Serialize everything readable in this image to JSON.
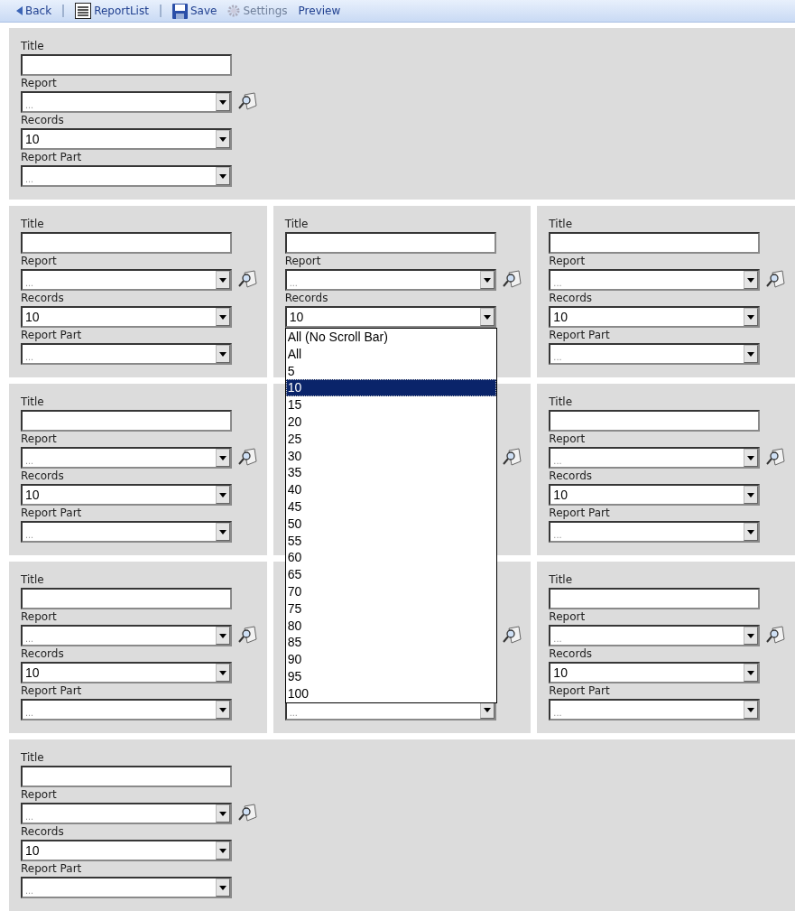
{
  "toolbar": {
    "items": [
      {
        "kind": "back",
        "label": "Back",
        "disabled": false
      },
      {
        "kind": "separator"
      },
      {
        "kind": "list",
        "label": "ReportList",
        "disabled": false
      },
      {
        "kind": "separator"
      },
      {
        "kind": "save",
        "label": "Save",
        "disabled": false
      },
      {
        "kind": "settings",
        "label": "Settings",
        "disabled": true
      },
      {
        "kind": "plain",
        "label": "Preview",
        "disabled": false
      }
    ]
  },
  "rows": [
    {
      "panels": [
        {
          "fields": [
            {
              "kind": "text",
              "label": "Title"
            },
            {
              "kind": "lookup",
              "label": "Report",
              "placeholder": "..."
            },
            {
              "kind": "select",
              "label": "Records",
              "value": "10"
            },
            {
              "kind": "select",
              "label": "Report Part",
              "placeholder": "..."
            }
          ]
        }
      ]
    },
    {
      "panels": [
        {
          "fields": [
            {
              "kind": "text",
              "label": "Title"
            },
            {
              "kind": "lookup",
              "label": "Report",
              "placeholder": "..."
            },
            {
              "kind": "select",
              "label": "Records",
              "value": "10"
            },
            {
              "kind": "select",
              "label": "Report Part",
              "placeholder": "..."
            }
          ]
        },
        {
          "fields": [
            {
              "kind": "text",
              "label": "Title"
            },
            {
              "kind": "lookup",
              "label": "Report",
              "placeholder": "..."
            },
            {
              "kind": "select",
              "label": "Records",
              "value": "10",
              "dropdown": {
                "options": [
                  {
                    "label": "All (No Scroll Bar)",
                    "selected": false
                  },
                  {
                    "label": "All",
                    "selected": false
                  },
                  {
                    "label": "5",
                    "selected": false
                  },
                  {
                    "label": "10",
                    "selected": true
                  },
                  {
                    "label": "15",
                    "selected": false
                  },
                  {
                    "label": "20",
                    "selected": false
                  },
                  {
                    "label": "25",
                    "selected": false
                  },
                  {
                    "label": "30",
                    "selected": false
                  },
                  {
                    "label": "35",
                    "selected": false
                  },
                  {
                    "label": "40",
                    "selected": false
                  },
                  {
                    "label": "45",
                    "selected": false
                  },
                  {
                    "label": "50",
                    "selected": false
                  },
                  {
                    "label": "55",
                    "selected": false
                  },
                  {
                    "label": "60",
                    "selected": false
                  },
                  {
                    "label": "65",
                    "selected": false
                  },
                  {
                    "label": "70",
                    "selected": false
                  },
                  {
                    "label": "75",
                    "selected": false
                  },
                  {
                    "label": "80",
                    "selected": false
                  },
                  {
                    "label": "85",
                    "selected": false
                  },
                  {
                    "label": "90",
                    "selected": false
                  },
                  {
                    "label": "95",
                    "selected": false
                  },
                  {
                    "label": "100",
                    "selected": false
                  }
                ]
              }
            },
            {
              "kind": "select"
            }
          ]
        },
        {
          "fields": [
            {
              "kind": "text",
              "label": "Title"
            },
            {
              "kind": "lookup",
              "label": "Report",
              "placeholder": "..."
            },
            {
              "kind": "select",
              "label": "Records",
              "value": "10"
            },
            {
              "kind": "select",
              "label": "Report Part",
              "placeholder": "..."
            }
          ]
        }
      ]
    },
    {
      "panels": [
        {
          "fields": [
            {
              "kind": "text",
              "label": "Title"
            },
            {
              "kind": "lookup",
              "label": "Report",
              "placeholder": "..."
            },
            {
              "kind": "select",
              "label": "Records",
              "value": "10"
            },
            {
              "kind": "select",
              "label": "Report Part",
              "placeholder": "..."
            }
          ]
        },
        {
          "fields": [
            {
              "kind": "text"
            },
            {
              "kind": "lookup"
            },
            {
              "kind": "select"
            },
            {
              "kind": "select"
            }
          ]
        },
        {
          "fields": [
            {
              "kind": "text",
              "label": "Title"
            },
            {
              "kind": "lookup",
              "label": "Report",
              "placeholder": "..."
            },
            {
              "kind": "select",
              "label": "Records",
              "value": "10"
            },
            {
              "kind": "select",
              "label": "Report Part",
              "placeholder": "..."
            }
          ]
        }
      ]
    },
    {
      "panels": [
        {
          "fields": [
            {
              "kind": "text",
              "label": "Title"
            },
            {
              "kind": "lookup",
              "label": "Report",
              "placeholder": "..."
            },
            {
              "kind": "select",
              "label": "Records",
              "value": "10"
            },
            {
              "kind": "select",
              "label": "Report Part",
              "placeholder": "..."
            }
          ]
        },
        {
          "fields": [
            {
              "kind": "text"
            },
            {
              "kind": "lookup"
            },
            {
              "kind": "select"
            },
            {
              "kind": "select",
              "placeholder": "..."
            }
          ]
        },
        {
          "fields": [
            {
              "kind": "text",
              "label": "Title"
            },
            {
              "kind": "lookup",
              "label": "Report",
              "placeholder": "..."
            },
            {
              "kind": "select",
              "label": "Records",
              "value": "10"
            },
            {
              "kind": "select",
              "label": "Report Part",
              "placeholder": "..."
            }
          ]
        }
      ]
    },
    {
      "panels": [
        {
          "fields": [
            {
              "kind": "text",
              "label": "Title"
            },
            {
              "kind": "lookup",
              "label": "Report",
              "placeholder": "..."
            },
            {
              "kind": "select",
              "label": "Records",
              "value": "10"
            },
            {
              "kind": "select",
              "label": "Report Part",
              "placeholder": "..."
            }
          ]
        }
      ]
    }
  ]
}
